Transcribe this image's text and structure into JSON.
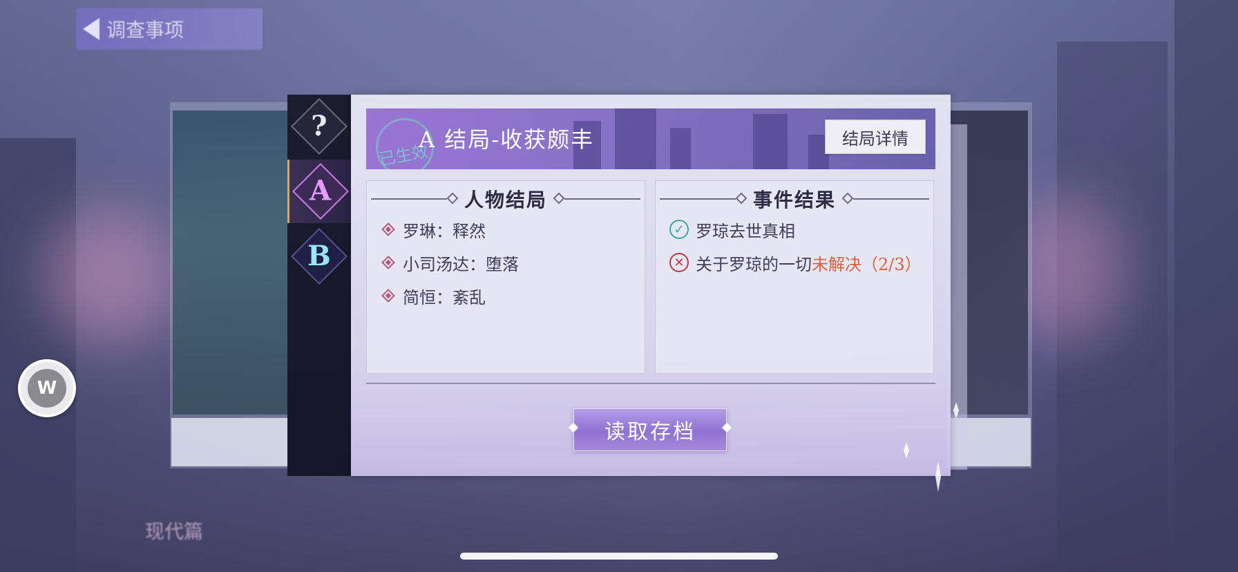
{
  "background": {
    "back_label": "调查事项",
    "bottom_tab_label": "现代篇"
  },
  "tabs": [
    {
      "symbol": "?",
      "name": "unknown"
    },
    {
      "symbol": "A",
      "name": "ending-a",
      "active": true
    },
    {
      "symbol": "B",
      "name": "ending-b"
    }
  ],
  "banner": {
    "seal": "已生效",
    "title": "A 结局-收获颇丰",
    "detail_button": "结局详情"
  },
  "characters": {
    "heading": "人物结局",
    "items": [
      "罗琳：释然",
      "小司汤达：堕落",
      "简恒：紊乱"
    ]
  },
  "events": {
    "heading": "事件结果",
    "items": [
      {
        "status": "done",
        "text": "罗琼去世真相",
        "suffix": ""
      },
      {
        "status": "fail",
        "text": "关于罗琼的一切",
        "suffix": "未解决（2/3）"
      }
    ]
  },
  "load_button": "读取存档",
  "colors": {
    "accent_purple": "#8f72d2",
    "success": "#3aa99a",
    "failure": "#c0364a",
    "warning": "#e0603a"
  }
}
